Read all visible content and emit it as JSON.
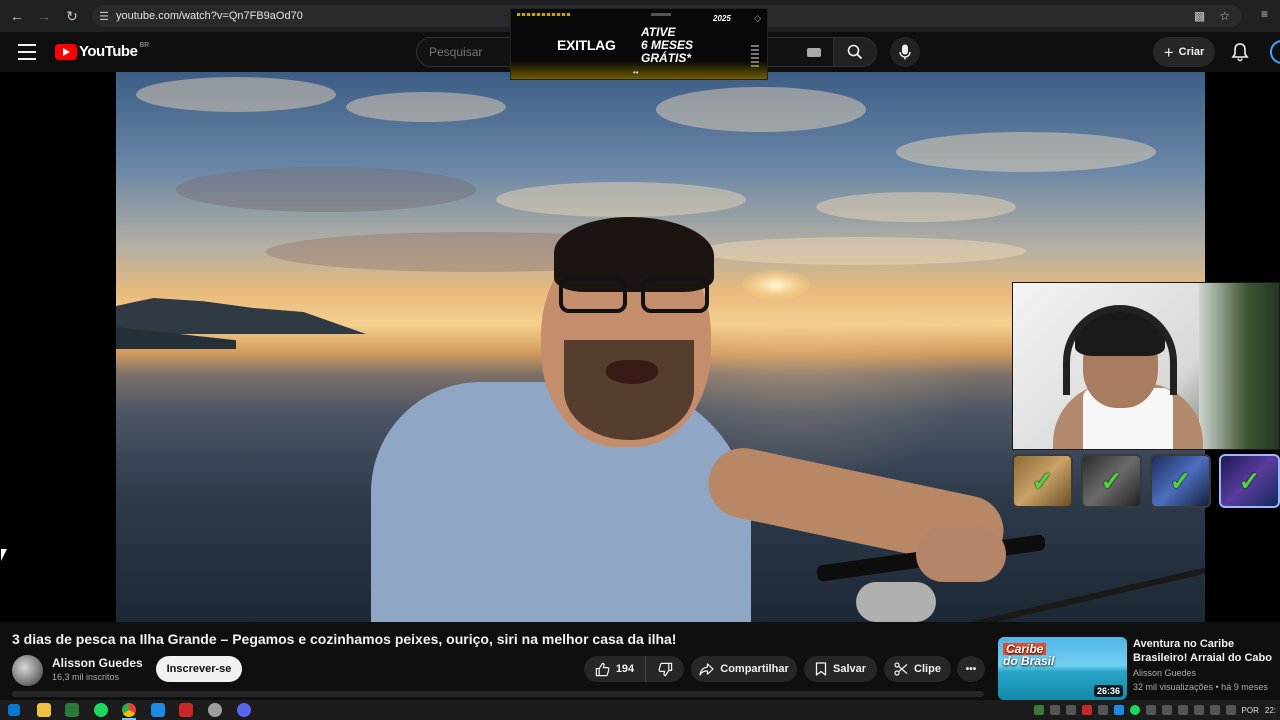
{
  "browser": {
    "url": "youtube.com/watch?v=Qn7FB9aOd70",
    "icons": [
      "back-icon",
      "forward-icon",
      "reload-icon",
      "site-info-icon",
      "install-app-icon",
      "bookmark-star-icon",
      "reading-list-icon"
    ]
  },
  "header": {
    "logo_text": "YouTube",
    "region": "BR",
    "search_placeholder": "Pesquisar",
    "create_label": "Criar"
  },
  "ad": {
    "badge": "2025",
    "brand": "EXITLAG",
    "line1": "ATIVE",
    "line2": "6 MESES",
    "line3": "GRÁTIS*",
    "accent": "#c8a400"
  },
  "video": {
    "title": "3 dias de pesca na Ilha Grande – Pegamos e cozinhamos peixes, ouriço, siri na melhor casa da ilha!",
    "channel": "Alisson Guedes",
    "subscribers": "16,3 mil inscritos",
    "subscribe_label": "Inscrever-se",
    "likes": "194",
    "share_label": "Compartilhar",
    "save_label": "Salvar",
    "clip_label": "Clipe",
    "more_label": "•••"
  },
  "recommendation": {
    "thumb_line1": "Caribe",
    "thumb_line2": "do Brasil",
    "duration": "26:36",
    "title": "Aventura no Caribe Brasileiro! Arraial do Cabo",
    "channel": "Alisson Guedes",
    "meta": "32 mil visualizações • há 9 meses"
  },
  "taskbar": {
    "language": "POR",
    "clock": "22:"
  },
  "colors": {
    "youtube_red": "#ff0000",
    "background": "#0f0f0f",
    "check_green": "#4ed43c"
  }
}
